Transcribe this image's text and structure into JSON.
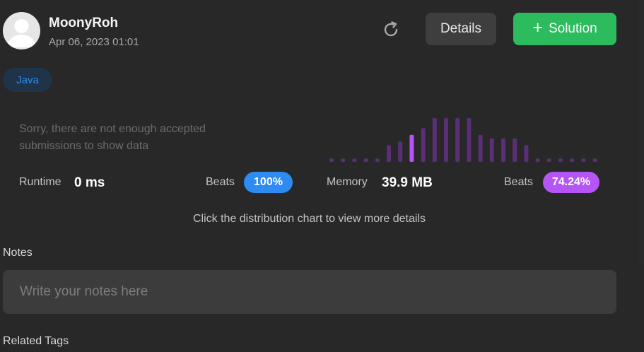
{
  "submission": {
    "user": "MoonyRoh",
    "date": "Apr 06, 2023 01:01",
    "language": "Java"
  },
  "actions": {
    "refresh_icon": "refresh-icon",
    "details_label": "Details",
    "solution_label": "Solution",
    "solution_icon": "plus-icon"
  },
  "runtime": {
    "message": "Sorry, there are not enough accepted submissions to show data",
    "label": "Runtime",
    "value": "0 ms",
    "beats_label": "Beats",
    "beats_value": "100%"
  },
  "memory": {
    "label": "Memory",
    "value": "39.9 MB",
    "beats_label": "Beats",
    "beats_value": "74.24%"
  },
  "hint": "Click the distribution chart to view more details",
  "notes": {
    "label": "Notes",
    "placeholder": "Write your notes here"
  },
  "related_tags_label": "Related Tags",
  "colors": {
    "accent_green": "#2cbb5d",
    "accent_blue": "#2d8bf1",
    "accent_purple": "#b655f6",
    "bar_dim": "#5a2f75"
  },
  "chart_data": {
    "type": "bar",
    "title": "",
    "xlabel": "",
    "ylabel": "",
    "values": [
      1,
      1,
      1,
      1,
      1,
      5,
      6,
      8,
      10,
      13,
      13,
      13,
      13,
      8,
      7,
      7,
      7,
      5,
      1,
      1,
      1,
      1,
      1,
      1
    ],
    "highlight_index": 7,
    "ylim": [
      0,
      13
    ]
  }
}
